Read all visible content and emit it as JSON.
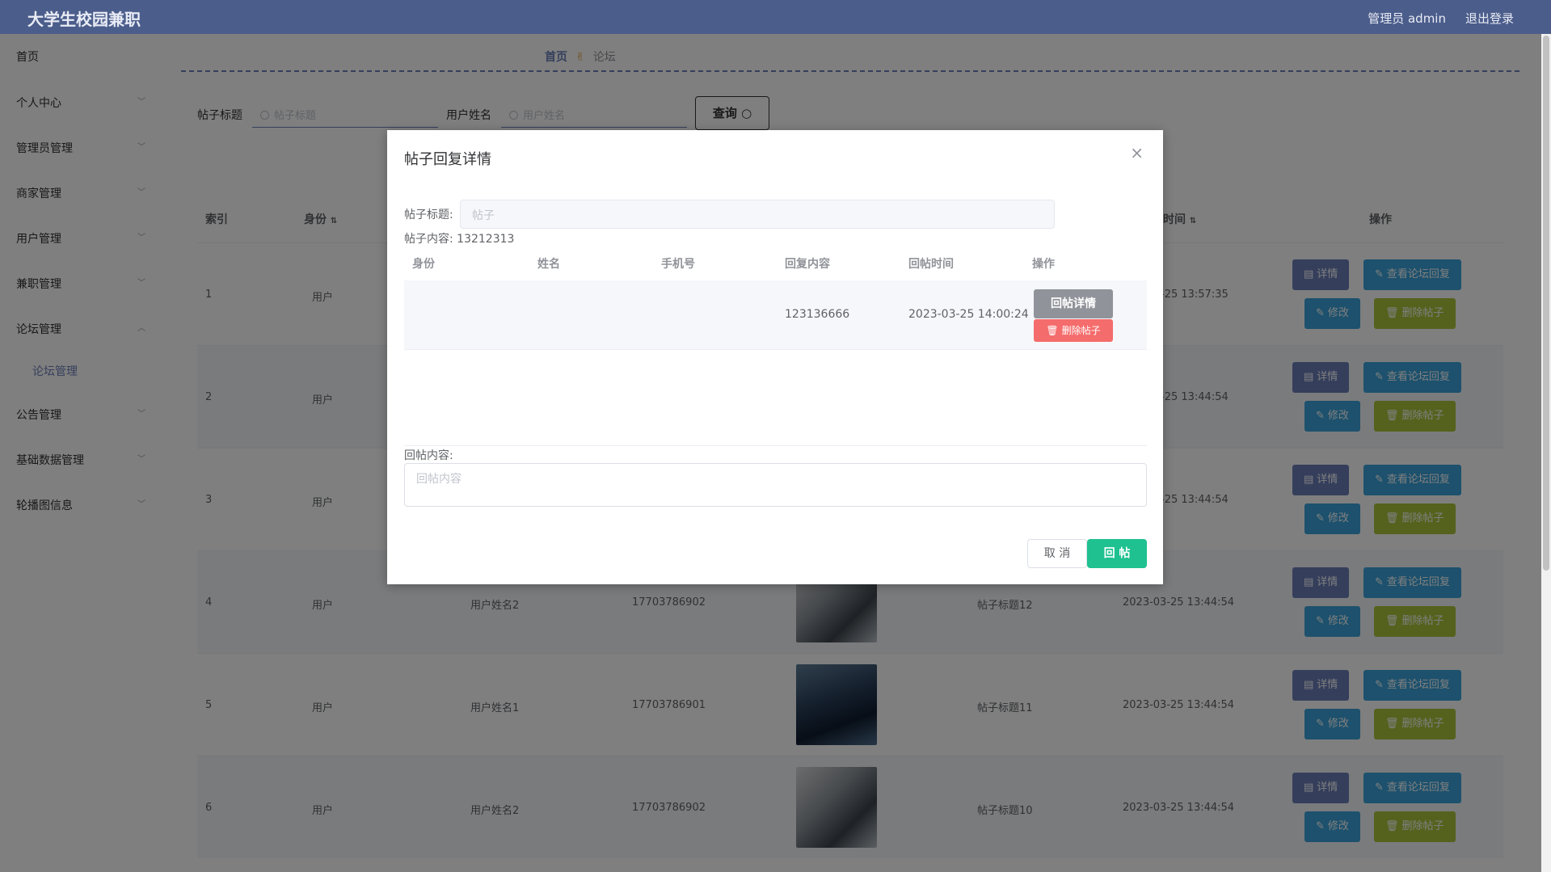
{
  "app": {
    "brand": "大学生校园兼职",
    "admin_label": "管理员 admin",
    "logout": "退出登录"
  },
  "sidebar": {
    "items": [
      "首页",
      "个人中心",
      "管理员管理",
      "商家管理",
      "用户管理",
      "兼职管理",
      "论坛管理",
      "公告管理",
      "基础数据管理",
      "轮播图信息"
    ],
    "sub_item": "论坛管理"
  },
  "breadcrumb": {
    "home": "首页",
    "current": "论坛"
  },
  "search": {
    "title_label": "帖子标题",
    "title_placeholder": "帖子标题",
    "user_label": "用户姓名",
    "user_placeholder": "用户姓名",
    "query_button": "查询"
  },
  "table": {
    "headers": {
      "index": "索引",
      "identity": "身份",
      "time": "时间",
      "actions": "操作"
    },
    "rows": [
      {
        "index": "1",
        "identity": "用户",
        "name": "",
        "phone": "",
        "title": "",
        "time": "-25 13:57:35"
      },
      {
        "index": "2",
        "identity": "用户",
        "name": "",
        "phone": "",
        "title": "",
        "time": "-25 13:44:54"
      },
      {
        "index": "3",
        "identity": "用户",
        "name": "",
        "phone": "",
        "title": "",
        "time": "-25 13:44:54"
      },
      {
        "index": "4",
        "identity": "用户",
        "name": "用户姓名2",
        "phone": "17703786902",
        "title": "帖子标题12",
        "time": "2023-03-25 13:44:54"
      },
      {
        "index": "5",
        "identity": "用户",
        "name": "用户姓名1",
        "phone": "17703786901",
        "title": "帖子标题11",
        "time": "2023-03-25 13:44:54"
      },
      {
        "index": "6",
        "identity": "用户",
        "name": "用户姓名2",
        "phone": "17703786902",
        "title": "帖子标题10",
        "time": "2023-03-25 13:44:54"
      }
    ],
    "buttons": {
      "detail": "详情",
      "view_reply": "查看论坛回复",
      "edit": "修改",
      "delete": "删除帖子"
    }
  },
  "dialog": {
    "title": "帖子回复详情",
    "post_title_label": "帖子标题:",
    "post_title_value": "帖子",
    "post_content_label": "帖子内容:",
    "post_content_value": "13212313",
    "headers": [
      "身份",
      "姓名",
      "手机号",
      "回复内容",
      "回帖时间",
      "操作"
    ],
    "reply": {
      "content": "123136666",
      "time": "2023-03-25 14:00:24"
    },
    "reply_detail_button": "回帖详情",
    "delete_button": "删除帖子",
    "reply_content_label": "回帖内容:",
    "reply_content_placeholder": "回帖内容",
    "cancel_button": "取 消",
    "submit_button": "回 帖"
  }
}
